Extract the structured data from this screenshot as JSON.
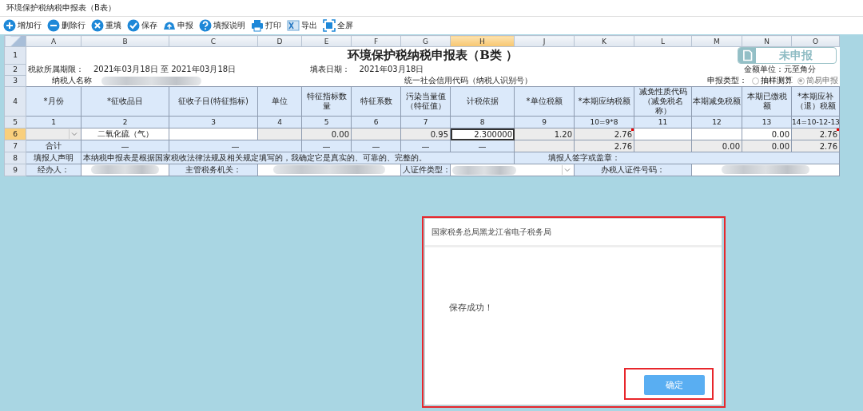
{
  "window": {
    "title": "环境保护税纳税申报表（B表）"
  },
  "toolbar": [
    {
      "kind": "add",
      "label": "增加行"
    },
    {
      "kind": "remove",
      "label": "删除行"
    },
    {
      "kind": "reset",
      "label": "重填"
    },
    {
      "kind": "save",
      "label": "保存"
    },
    {
      "kind": "submit",
      "label": "申报"
    },
    {
      "kind": "help",
      "label": "填报说明"
    },
    {
      "kind": "print",
      "label": "打印"
    },
    {
      "kind": "export",
      "label": "导出"
    },
    {
      "kind": "fullscreen",
      "label": "全屏"
    }
  ],
  "columns": [
    {
      "label": "A",
      "selected": false
    },
    {
      "label": "B",
      "selected": false
    },
    {
      "label": "C",
      "selected": false
    },
    {
      "label": "D",
      "selected": false
    },
    {
      "label": "E",
      "selected": false
    },
    {
      "label": "F",
      "selected": false
    },
    {
      "label": "G",
      "selected": false
    },
    {
      "label": "H",
      "selected": true
    },
    {
      "label": "J",
      "selected": false
    },
    {
      "label": "K",
      "selected": false
    },
    {
      "label": "L",
      "selected": false
    },
    {
      "label": "M",
      "selected": false
    },
    {
      "label": "N",
      "selected": false
    },
    {
      "label": "O",
      "selected": false
    }
  ],
  "row_numbers": [
    {
      "label": "1",
      "selected": false
    },
    {
      "label": "2",
      "selected": false
    },
    {
      "label": "3",
      "selected": false
    },
    {
      "label": "4",
      "selected": false
    },
    {
      "label": "5",
      "selected": false
    },
    {
      "label": "6",
      "selected": true
    },
    {
      "label": "7",
      "selected": false
    },
    {
      "label": "8",
      "selected": false
    },
    {
      "label": "9",
      "selected": false
    }
  ],
  "form": {
    "title": "环境保护税纳税申报表（B类 ）",
    "status_badge": "未申报",
    "period_label": "税款所属期限：",
    "period_value": "2021年03月18日 至 2021年03月18日",
    "fill_date_label": "填表日期：",
    "fill_date_value": "2021年03月18日",
    "currency_unit": "金额单位：元至角分",
    "taxpayer_name_label": "纳税人名称",
    "credit_code_label": "统一社会信用代码（纳税人识别号）",
    "report_type_label": "申报类型：",
    "report_types": [
      {
        "label": "抽样测算",
        "selected": false
      },
      {
        "label": "简易申报",
        "selected": true
      }
    ]
  },
  "headers": [
    "*月份",
    "*征收品目",
    "征收子目(特征指标)",
    "单位",
    "特征指标数量",
    "特征系数",
    "污染当量值（特征值）",
    "计税依据",
    "*单位税额",
    "*本期应纳税额",
    "减免性质代码（减免税名称）",
    "本期减免税额",
    "本期已缴税额",
    "*本期应补（退）税额"
  ],
  "column_numbers": [
    "1",
    "2",
    "3",
    "4",
    "5",
    "6",
    "7",
    "8",
    "9",
    "10=9*8",
    "11",
    "12",
    "13",
    "14=10-12-13"
  ],
  "data_row": [
    {
      "kind": "dropdown",
      "selected": false,
      "flagged": false
    },
    {
      "kind": "input",
      "text": "二氧化硫（气）",
      "selected": false,
      "flagged": false
    },
    {
      "kind": "input",
      "selected": false,
      "flagged": false
    },
    {
      "kind": "readonly",
      "selected": false,
      "flagged": false
    },
    {
      "kind": "readonly",
      "text": "0.00",
      "selected": false,
      "flagged": false
    },
    {
      "kind": "readonly",
      "selected": false,
      "flagged": false
    },
    {
      "kind": "readonly",
      "text": "0.95",
      "selected": false,
      "flagged": false
    },
    {
      "kind": "input",
      "text": "2.300000",
      "selected": true,
      "flagged": false
    },
    {
      "kind": "readonly",
      "text": "1.20",
      "selected": false,
      "flagged": false
    },
    {
      "kind": "readonly",
      "text": "2.76",
      "selected": false,
      "flagged": true
    },
    {
      "kind": "input",
      "selected": false,
      "flagged": false
    },
    {
      "kind": "input",
      "selected": false,
      "flagged": false
    },
    {
      "kind": "input",
      "text": "0.00",
      "selected": false,
      "flagged": false
    },
    {
      "kind": "readonly",
      "text": "2.76",
      "selected": false,
      "flagged": true
    }
  ],
  "total_row": [
    {
      "kind": "label",
      "text": "合计"
    },
    {
      "kind": "label",
      "text": "—"
    },
    {
      "kind": "label",
      "text": "—"
    },
    {
      "kind": "label",
      "text": "—"
    },
    {
      "kind": "label",
      "text": "—"
    },
    {
      "kind": "label",
      "text": "—"
    },
    {
      "kind": "label",
      "text": "—"
    },
    {
      "kind": "readonly"
    },
    {
      "kind": "readonly",
      "text": "2.76"
    },
    {
      "kind": "readonly"
    },
    {
      "kind": "readonly",
      "text": "0.00"
    },
    {
      "kind": "readonly",
      "text": "0.00"
    },
    {
      "kind": "readonly",
      "text": "2.76"
    }
  ],
  "declaration": {
    "label": "填报人声明",
    "statement": "本纳税申报表是根据国家税收法律法规及相关规定填写的，我确定它是真实的、可靠的、完整的。",
    "signature_label": "填报人签字或盖章："
  },
  "signoff": {
    "handler_label": "经办人：",
    "tax_authority_label": "主管税务机关：",
    "id_type_label": "人证件类型：",
    "id_number_label": "办税人证件号码："
  },
  "dialog": {
    "title": "国家税务总局黑龙江省电子税务局",
    "message": "保存成功！",
    "button": "确定"
  }
}
